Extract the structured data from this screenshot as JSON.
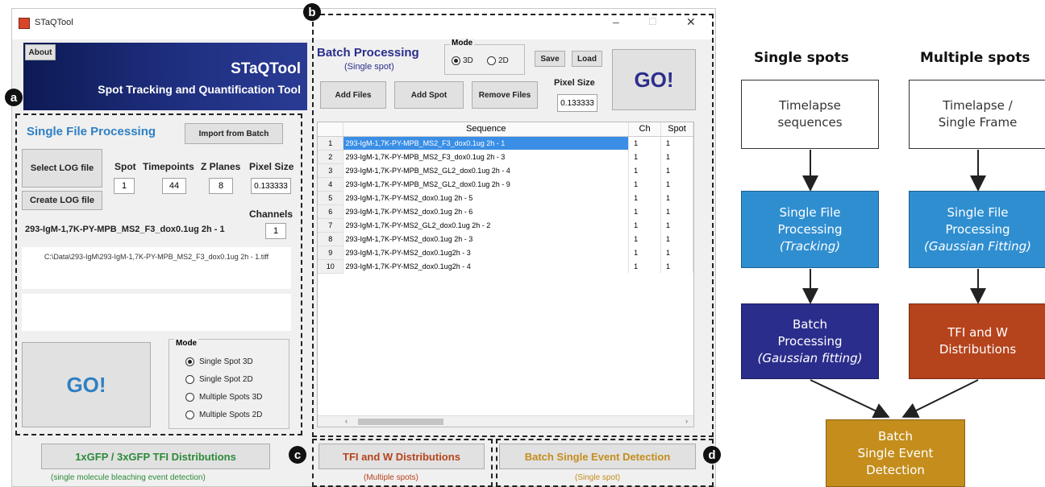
{
  "window": {
    "title": "STaQTool",
    "controls": [
      "–",
      "□",
      "✕"
    ]
  },
  "badges": {
    "a": "a",
    "b": "b",
    "c": "c",
    "d": "d"
  },
  "header": {
    "about": "About",
    "app_name": "STaQTool",
    "app_subtitle": "Spot Tracking and Quantification Tool"
  },
  "single_file": {
    "title": "Single File Processing",
    "import_button": "Import from Batch",
    "select_log": "Select LOG file",
    "create_log": "Create LOG file",
    "spot_label": "Spot",
    "spot_value": "1",
    "timepoints_label": "Timepoints",
    "timepoints_value": "44",
    "zplanes_label": "Z Planes",
    "zplanes_value": "8",
    "pixel_label": "Pixel Size",
    "pixel_value": "0.133333",
    "channels_label": "Channels",
    "channels_value": "1",
    "file_name": "293-IgM-1,7K-PY-MPB_MS2_F3_dox0.1ug 2h - 1",
    "file_path": "C:\\Data\\293-IgM\\293-IgM-1,7K-PY-MPB_MS2_F3_dox0.1ug 2h - 1.tiff",
    "go": "GO!",
    "mode_title": "Mode",
    "modes": [
      "Single Spot 3D",
      "Single Spot 2D",
      "Multiple Spots 3D",
      "Multiple Spots 2D"
    ]
  },
  "tfi_gfp": {
    "button": "1xGFP / 3xGFP TFI Distributions",
    "caption": "(single molecule bleaching event detection)"
  },
  "batch": {
    "title": "Batch Processing",
    "subtitle": "(Single spot)",
    "mode_title": "Mode",
    "mode_3d": "3D",
    "mode_2d": "2D",
    "save": "Save",
    "load": "Load",
    "add_files": "Add Files",
    "add_spot": "Add Spot",
    "remove_files": "Remove Files",
    "pixel_label": "Pixel Size",
    "pixel_value": "0.133333",
    "go": "GO!",
    "columns": [
      "Sequence",
      "Ch",
      "Spot"
    ],
    "rows": [
      {
        "n": "1",
        "seq": "293-IgM-1,7K-PY-MPB_MS2_F3_dox0.1ug 2h - 1",
        "ch": "1",
        "spot": "1"
      },
      {
        "n": "2",
        "seq": "293-IgM-1,7K-PY-MPB_MS2_F3_dox0.1ug 2h - 3",
        "ch": "1",
        "spot": "1"
      },
      {
        "n": "3",
        "seq": "293-IgM-1,7K-PY-MPB_MS2_GL2_dox0.1ug 2h - 4",
        "ch": "1",
        "spot": "1"
      },
      {
        "n": "4",
        "seq": "293-IgM-1,7K-PY-MPB_MS2_GL2_dox0.1ug 2h - 9",
        "ch": "1",
        "spot": "1"
      },
      {
        "n": "5",
        "seq": "293-IgM-1,7K-PY-MS2_dox0.1ug 2h - 5",
        "ch": "1",
        "spot": "1"
      },
      {
        "n": "6",
        "seq": "293-IgM-1,7K-PY-MS2_dox0.1ug 2h - 6",
        "ch": "1",
        "spot": "1"
      },
      {
        "n": "7",
        "seq": "293-IgM-1,7K-PY-MS2_GL2_dox0.1ug 2h - 2",
        "ch": "1",
        "spot": "1"
      },
      {
        "n": "8",
        "seq": "293-IgM-1,7K-PY-MS2_dox0.1ug 2h - 3",
        "ch": "1",
        "spot": "1"
      },
      {
        "n": "9",
        "seq": "293-IgM-1,7K-PY-MS2_dox0.1ug2h - 3",
        "ch": "1",
        "spot": "1"
      },
      {
        "n": "10",
        "seq": "293-IgM-1,7K-PY-MS2_dox0.1ug2h - 4",
        "ch": "1",
        "spot": "1"
      }
    ]
  },
  "tfi_w": {
    "button": "TFI and W Distributions",
    "caption": "(Multiple spots)"
  },
  "bsed": {
    "button": "Batch Single Event Detection",
    "caption": "(Single spot)"
  },
  "flow": {
    "col1_title": "Single spots",
    "col2_title": "Multiple spots",
    "box_timelapse": [
      "Timelapse",
      "sequences"
    ],
    "box_timelapse_single": [
      "Timelapse /",
      "Single Frame"
    ],
    "box_sfp_tracking": [
      "Single File",
      "Processing",
      "(Tracking)"
    ],
    "box_sfp_gauss": [
      "Single File",
      "Processing",
      "(Gaussian Fitting)"
    ],
    "box_batch": [
      "Batch",
      "Processing",
      "(Gaussian fitting)"
    ],
    "box_tfi": [
      "TFI and W",
      "Distributions"
    ],
    "box_bsed": [
      "Batch",
      "Single Event",
      "Detection"
    ]
  },
  "colors": {
    "accent_blue": "#2f7fc3",
    "sfp_blue": "#2f8ed0",
    "batch_navy": "#2b2d8c",
    "tfi_red": "#b5431c",
    "bsed_gold": "#c48d1c",
    "header_navy": "#1f2f80"
  }
}
